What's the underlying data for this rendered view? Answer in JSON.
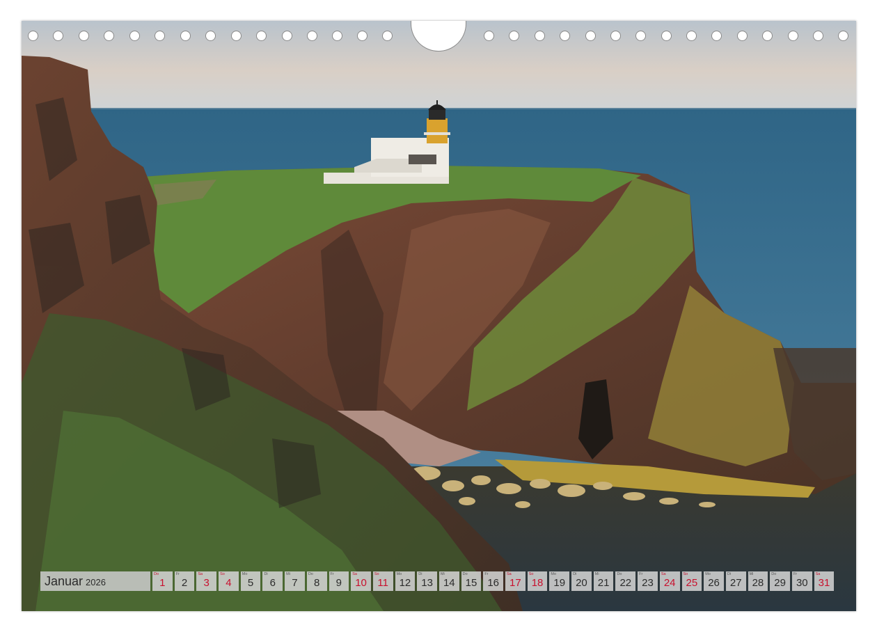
{
  "calendar": {
    "month": "Januar",
    "year": "2026",
    "days": [
      {
        "wd": "Do",
        "num": "1",
        "weekend": true
      },
      {
        "wd": "Fr",
        "num": "2",
        "weekend": false
      },
      {
        "wd": "Sa",
        "num": "3",
        "weekend": true
      },
      {
        "wd": "So",
        "num": "4",
        "weekend": true
      },
      {
        "wd": "Mo",
        "num": "5",
        "weekend": false
      },
      {
        "wd": "Di",
        "num": "6",
        "weekend": false
      },
      {
        "wd": "Mi",
        "num": "7",
        "weekend": false
      },
      {
        "wd": "Do",
        "num": "8",
        "weekend": false
      },
      {
        "wd": "Fr",
        "num": "9",
        "weekend": false
      },
      {
        "wd": "Sa",
        "num": "10",
        "weekend": true
      },
      {
        "wd": "So",
        "num": "11",
        "weekend": true
      },
      {
        "wd": "Mo",
        "num": "12",
        "weekend": false
      },
      {
        "wd": "Di",
        "num": "13",
        "weekend": false
      },
      {
        "wd": "Mi",
        "num": "14",
        "weekend": false
      },
      {
        "wd": "Do",
        "num": "15",
        "weekend": false
      },
      {
        "wd": "Fr",
        "num": "16",
        "weekend": false
      },
      {
        "wd": "Sa",
        "num": "17",
        "weekend": true
      },
      {
        "wd": "So",
        "num": "18",
        "weekend": true
      },
      {
        "wd": "Mo",
        "num": "19",
        "weekend": false
      },
      {
        "wd": "Di",
        "num": "20",
        "weekend": false
      },
      {
        "wd": "Mi",
        "num": "21",
        "weekend": false
      },
      {
        "wd": "Do",
        "num": "22",
        "weekend": false
      },
      {
        "wd": "Fr",
        "num": "23",
        "weekend": false
      },
      {
        "wd": "Sa",
        "num": "24",
        "weekend": true
      },
      {
        "wd": "So",
        "num": "25",
        "weekend": true
      },
      {
        "wd": "Mo",
        "num": "26",
        "weekend": false
      },
      {
        "wd": "Di",
        "num": "27",
        "weekend": false
      },
      {
        "wd": "Mi",
        "num": "28",
        "weekend": false
      },
      {
        "wd": "Do",
        "num": "29",
        "weekend": false
      },
      {
        "wd": "Fr",
        "num": "30",
        "weekend": false
      },
      {
        "wd": "Sa",
        "num": "31",
        "weekend": true
      }
    ]
  },
  "colors": {
    "weekend": "#c8102e",
    "sea": "#3c6f8f",
    "grass": "#5f8a3a",
    "cliff": "#6e4434"
  },
  "icons": {
    "binding_holes": "ring-binding-holes",
    "hanger": "wall-hanger-cutout"
  }
}
